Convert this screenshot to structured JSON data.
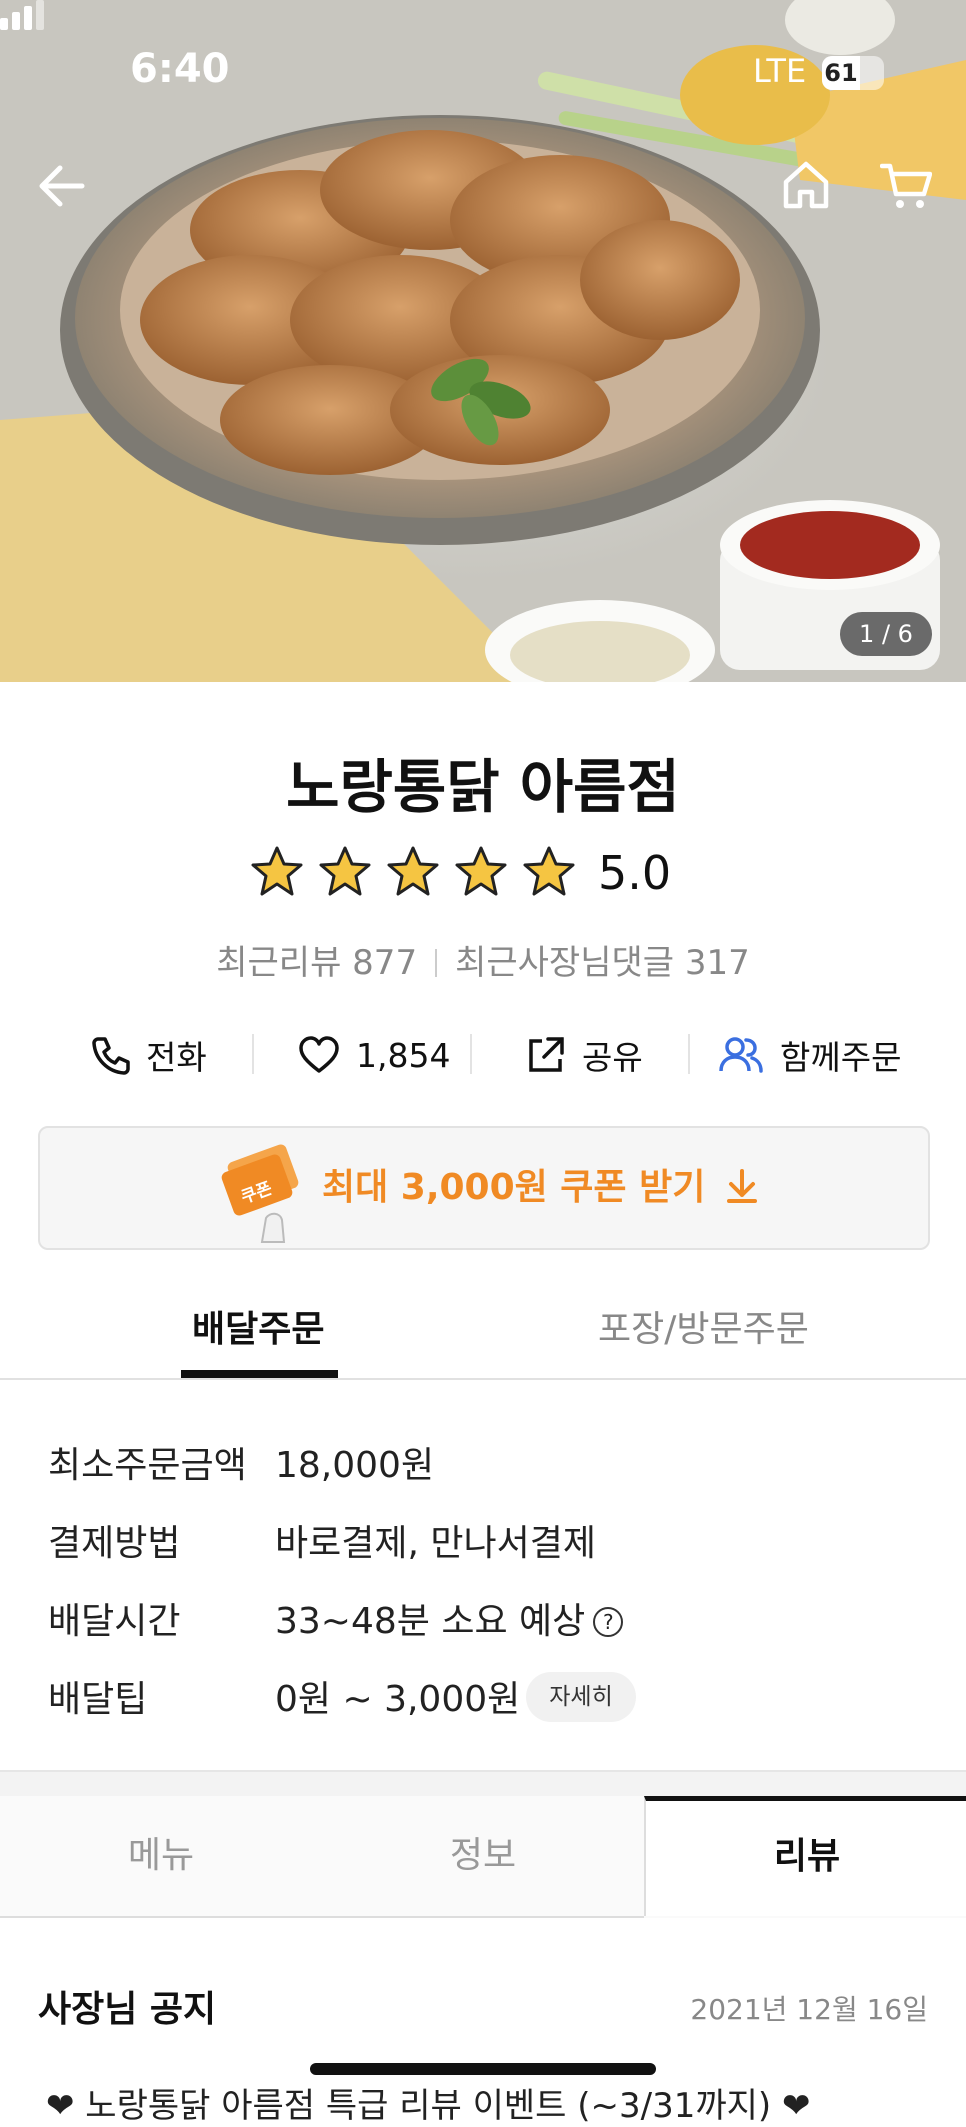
{
  "status_bar": {
    "time": "6:40",
    "network": "LTE",
    "battery": "61"
  },
  "gallery": {
    "counter": "1 / 6"
  },
  "store": {
    "name": "노랑통닭 아름점",
    "rating": "5.0",
    "stars": 5,
    "recent_reviews": "최근리뷰 877",
    "owner_replies": "최근사장님댓글 317"
  },
  "actions": {
    "call": "전화",
    "likes": "1,854",
    "share": "공유",
    "group_order": "함께주문"
  },
  "coupon": {
    "badge": "쿠폰",
    "text": "최대 3,000원 쿠폰 받기"
  },
  "order_tabs": {
    "delivery": "배달주문",
    "pickup": "포장/방문주문"
  },
  "order_info": [
    {
      "label": "최소주문금액",
      "value": "18,000원"
    },
    {
      "label": "결제방법",
      "value": "바로결제, 만나서결제"
    },
    {
      "label": "배달시간",
      "value": "33~48분 소요 예상"
    },
    {
      "label": "배달팁",
      "value": "0원 ~ 3,000원"
    }
  ],
  "detail_button": "자세히",
  "help_mark": "?",
  "section_tabs": {
    "menu": "메뉴",
    "info": "정보",
    "reviews": "리뷰"
  },
  "notice": {
    "title": "사장님 공지",
    "date": "2021년 12월 16일",
    "preview": "❤ 노랑통닭 아름점 특급 리뷰 이벤트 (~3/31까지) ❤"
  },
  "colors": {
    "accent": "#f08a24",
    "blue_icon": "#3b6fe0"
  }
}
